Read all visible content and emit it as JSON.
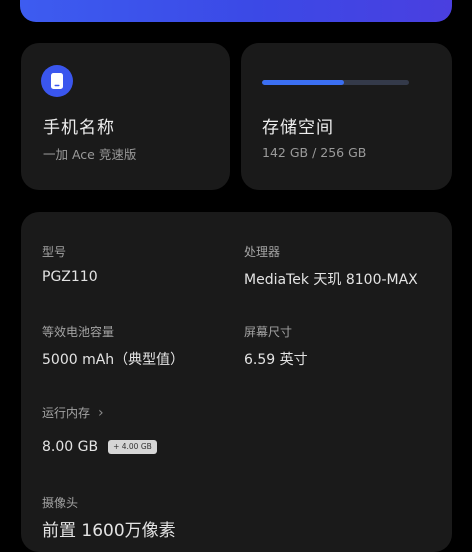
{
  "colors": {
    "accent": "#3a56ee",
    "card_background": "#1a1a1a",
    "page_background": "#000000",
    "storage_fill": "#3b6ff2"
  },
  "phone_card": {
    "icon": "phone-icon",
    "title": "手机名称",
    "subtitle": "一加 Ace 竞速版"
  },
  "storage_card": {
    "title": "存储空间",
    "usage": "142 GB / 256 GB",
    "used_fraction": 0.555
  },
  "specs": {
    "model": {
      "label": "型号",
      "value": "PGZ110"
    },
    "processor": {
      "label": "处理器",
      "value": "MediaTek 天玑 8100-MAX"
    },
    "battery": {
      "label": "等效电池容量",
      "value": "5000 mAh（典型值）"
    },
    "screen": {
      "label": "屏幕尺寸",
      "value": "6.59 英寸"
    },
    "ram": {
      "label": "运行内存",
      "value": "8.00 GB",
      "extra_badge": "+ 4.00 GB",
      "chevron_icon": "chevron-right-icon"
    },
    "camera": {
      "label": "摄像头",
      "value": "前置 1600万像素"
    }
  }
}
